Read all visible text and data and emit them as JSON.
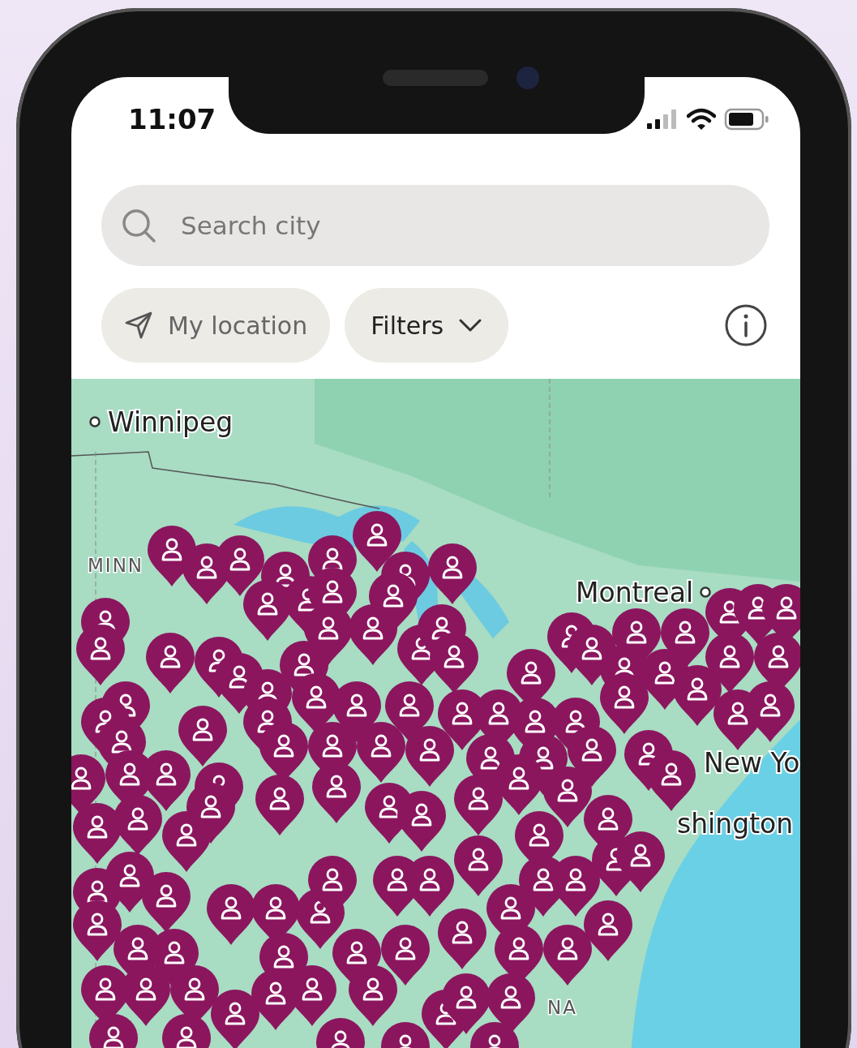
{
  "status_bar": {
    "time": "11:07"
  },
  "search": {
    "placeholder": "Search city"
  },
  "buttons": [
    {
      "label": "My location",
      "kind": "location"
    },
    {
      "label": "Filters",
      "kind": "dropdown"
    }
  ],
  "map": {
    "labels": [
      {
        "text": "Winnipeg",
        "kind": "dot_left"
      },
      {
        "text": "MINN",
        "kind": "region"
      },
      {
        "text": "Montreal",
        "kind": "dot_right"
      },
      {
        "text": "New Yo",
        "kind": "plain"
      },
      {
        "text": "shington",
        "kind": "plain"
      },
      {
        "text": "NA",
        "kind": "region"
      }
    ]
  }
}
